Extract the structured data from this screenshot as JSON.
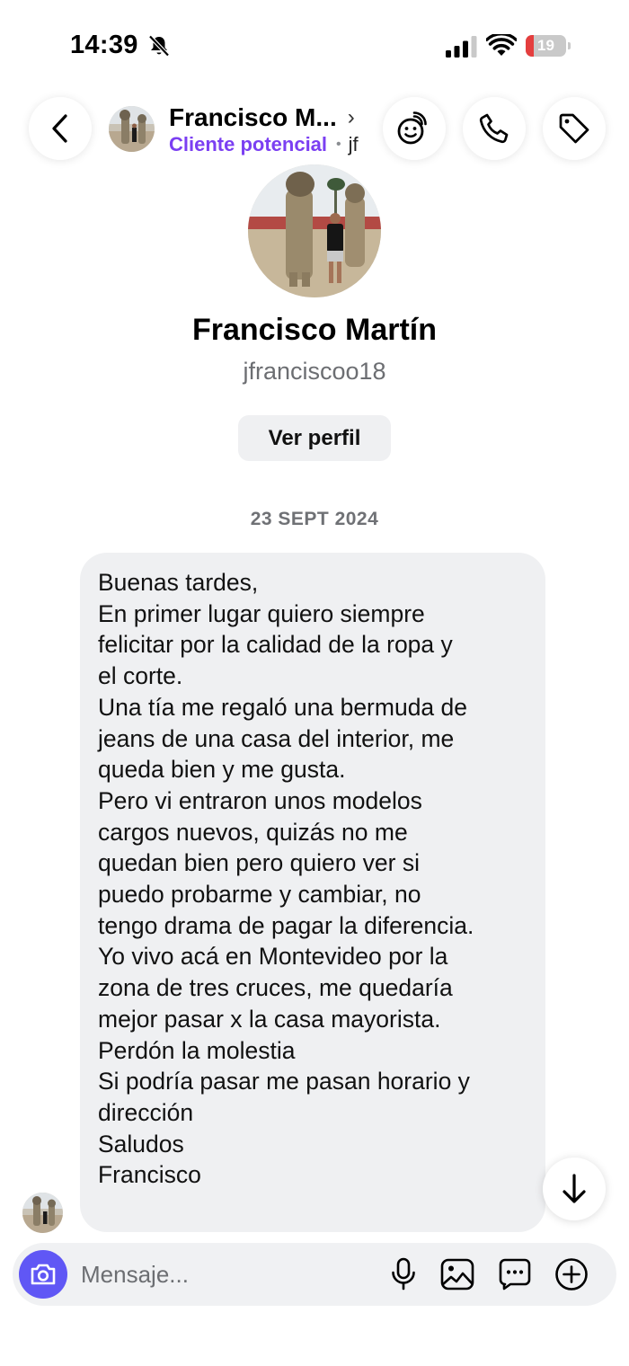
{
  "status_bar": {
    "time": "14:39",
    "battery_level": "19",
    "battery_fraction": 0.19,
    "icons": [
      "bell-slash-icon",
      "signal-icon",
      "wifi-icon",
      "battery-icon"
    ]
  },
  "header": {
    "contact_name": "Francisco M...",
    "chevron": "›",
    "label": "Cliente potencial",
    "separator": "•",
    "username_fragment": "jf",
    "icons": [
      "back-icon",
      "games-icon",
      "phone-icon",
      "tag-icon"
    ]
  },
  "profile": {
    "name": "Francisco Martín",
    "username": "jfranciscoo18",
    "view_profile_label": "Ver perfil"
  },
  "thread": {
    "date": "23 SEPT 2024",
    "message_lines": [
      "Buenas tardes,",
      "En primer lugar quiero siempre",
      "felicitar por la calidad de la ropa y",
      "el corte.",
      "Una tía me regaló una bermuda de",
      "jeans de una casa del interior, me",
      "queda bien y me gusta.",
      "Pero vi entraron unos modelos",
      "cargos nuevos, quizás no me",
      "quedan bien pero quiero ver si",
      "puedo probarme y cambiar, no",
      "tengo drama de pagar la diferencia.",
      "Yo vivo acá en Montevideo por la",
      "zona de tres cruces, me quedaría",
      "mejor pasar x la casa mayorista.",
      "Perdón la molestia",
      "Si podría pasar me pasan horario y",
      "dirección",
      "Saludos",
      "Francisco"
    ]
  },
  "composer": {
    "placeholder": "Mensaje...",
    "icons": [
      "camera-icon",
      "microphone-icon",
      "gallery-icon",
      "sticker-icon",
      "plus-icon"
    ]
  },
  "colors": {
    "accent": "#6057f5",
    "lead_label": "#7b3ff2",
    "bubble": "#eff0f2",
    "battery_low": "#e43e3e"
  }
}
